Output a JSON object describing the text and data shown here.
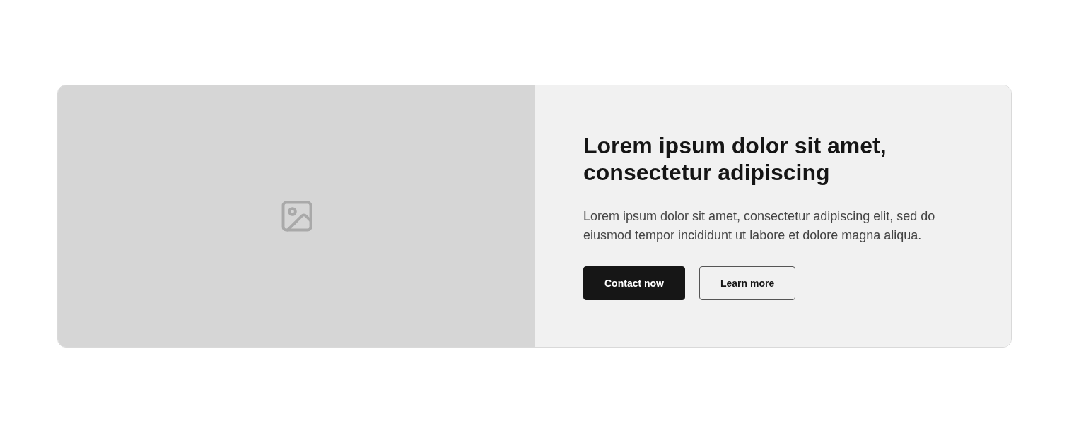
{
  "hero": {
    "media": {
      "kind": "image-placeholder"
    },
    "heading": "Lorem ipsum dolor sit amet, consectetur adipiscing",
    "body": "Lorem ipsum dolor sit amet, consectetur adipiscing elit, sed do eiusmod tempor incididunt ut labore et dolore magna aliqua.",
    "buttons": [
      {
        "label": "Contact now",
        "kind": "primary"
      },
      {
        "label": "Learn more",
        "kind": "secondary"
      }
    ]
  }
}
